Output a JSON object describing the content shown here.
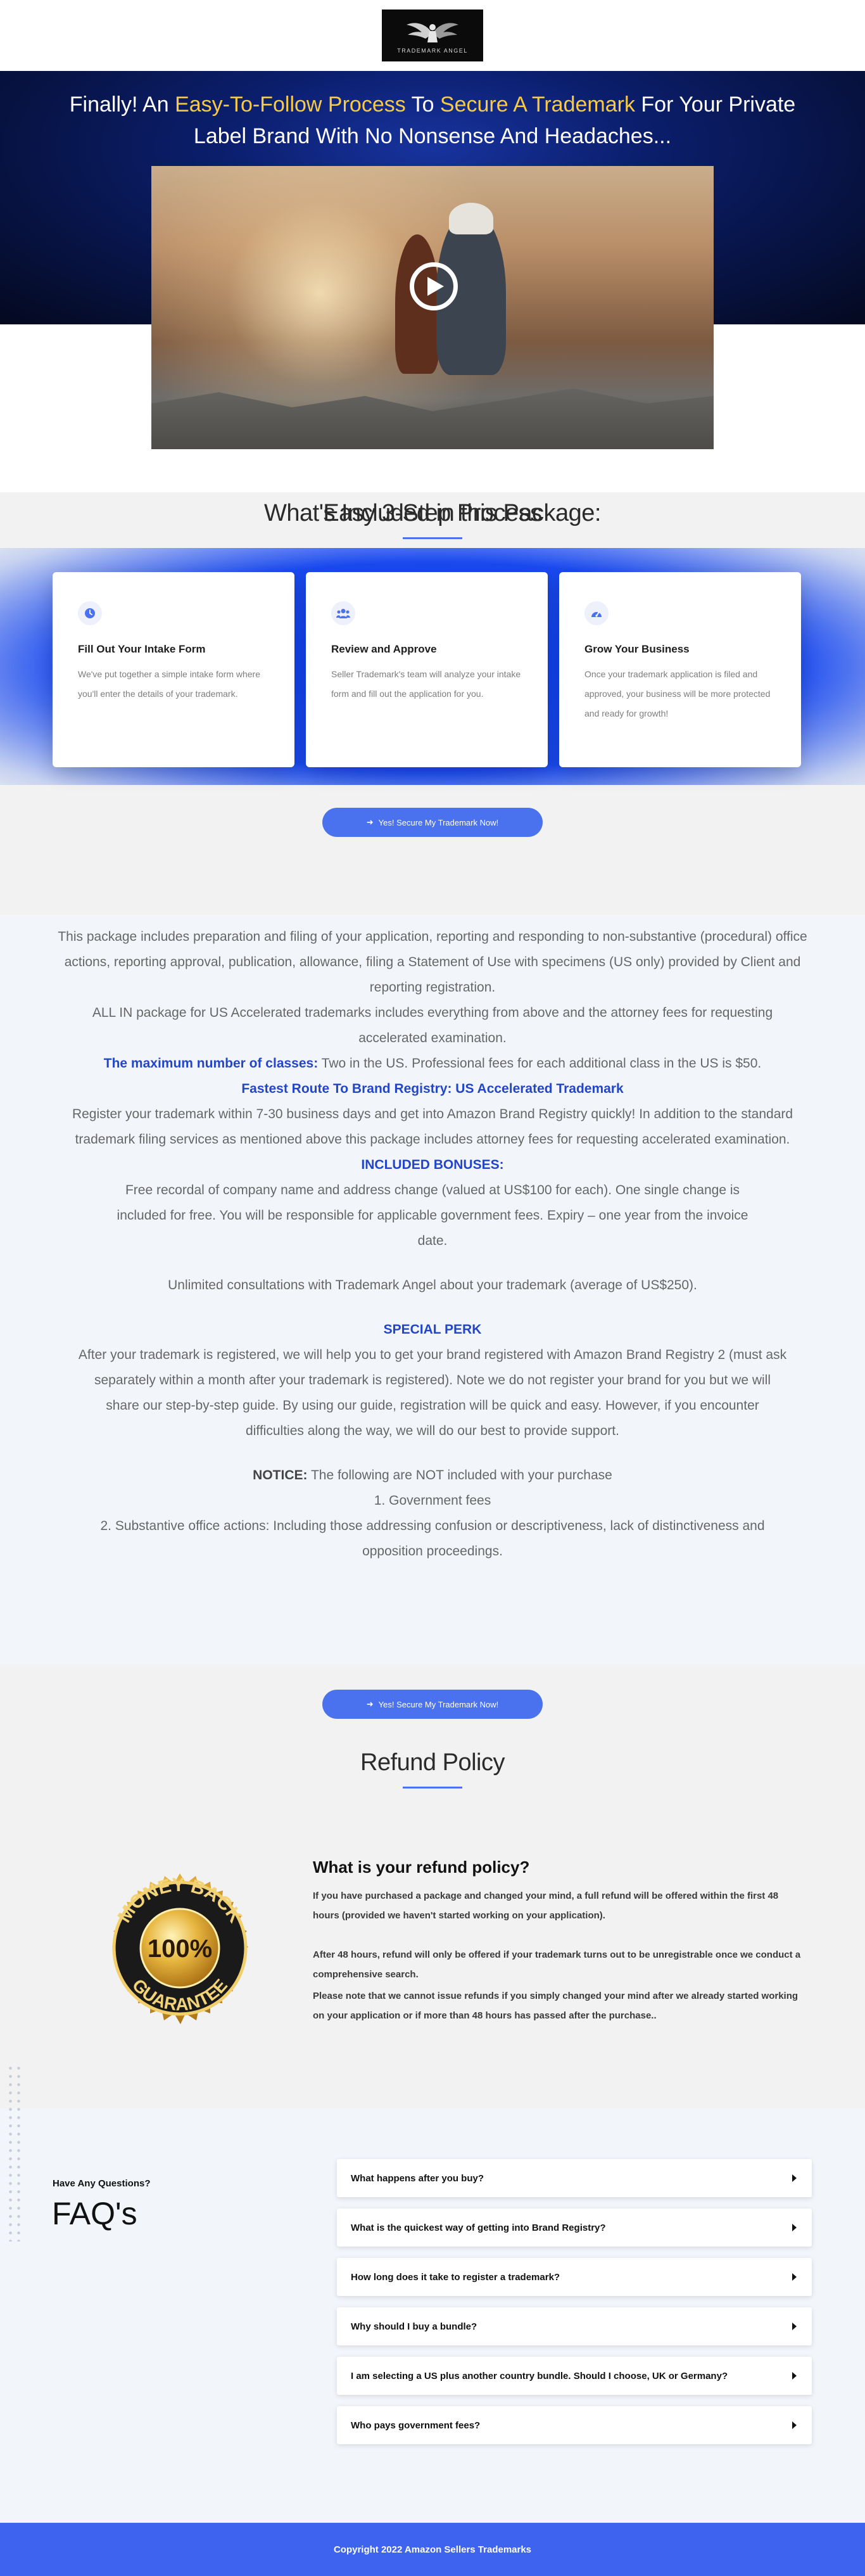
{
  "logo": {
    "text": "TRADEMARK ANGEL"
  },
  "hero": {
    "title_parts": [
      "Finally! An ",
      "Easy-To-Follow Process",
      " To ",
      "Secure A Trademark",
      " For Your Private Label Brand With No Nonsense And Headaches..."
    ],
    "accent_color": "#f7c948",
    "video": {
      "play_icon": "play-icon"
    }
  },
  "cta": {
    "label": "Yes! Secure My Trademark Now!",
    "icon": "arrow-right-icon",
    "color": "#4a72ef"
  },
  "steps_section": {
    "title": "Easy 3-Step Process",
    "steps": [
      {
        "icon": "clock-icon",
        "title": "Fill Out Your Intake Form",
        "text": "We've put together a simple intake form where you'll enter the details of your trademark."
      },
      {
        "icon": "users-icon",
        "title": "Review and Approve",
        "text": "Seller Trademark's team will analyze your intake form and fill out the application for you."
      },
      {
        "icon": "gauge-icon",
        "title": "Grow Your Business",
        "text": "Once your trademark application is filed and approved, your business will be more protected and ready for growth!"
      }
    ]
  },
  "package": {
    "title": "What's Included in this Package:",
    "intro": "This package includes preparation and filing of your application, reporting and responding to non-substantive (procedural) office actions, reporting approval, publication, allowance, filing a Statement of Use with specimens (US only) provided by Client and reporting registration.",
    "all_in": "ALL IN package for US Accelerated trademarks includes everything from above and the attorney fees for requesting accelerated examination.",
    "max_classes_label": "The maximum number of classes:",
    "max_classes_text": " Two in the US. Professional fees for each additional class in the US is $50.",
    "fastest_route": "Fastest Route To Brand Registry: US Accelerated Trademark",
    "register_text": "Register your trademark within 7-30 business days and get into Amazon Brand Registry quickly! In addition to the standard trademark filing services as mentioned above this package includes attorney fees for requesting accelerated examination.",
    "bonuses_heading": "INCLUDED BONUSES:",
    "bonus_1": "Free recordal of company name and address change (valued at US$100 for each). One single change is included for free. You will be responsible for applicable government fees. Expiry – one year from the invoice date.",
    "bonus_2": "Unlimited consultations with Trademark Angel about your trademark (average of US$250).",
    "perk_heading": "SPECIAL PERK",
    "perk_text": "After your trademark is registered, we will help you to get your brand registered with Amazon Brand Registry 2 (must ask separately within a month after your trademark is registered). Note we do not register your brand for you but we will share our step-by-step guide. By using our guide, registration will be quick and easy. However, if you encounter difficulties along the way, we will do our best to provide support.",
    "notice_label": "NOTICE:",
    "notice_text": " The following are NOT included with your purchase",
    "notice_1": "1. Government fees",
    "notice_2": "2. Substantive office actions: Including those addressing confusion or descriptiveness, lack of distinctiveness and opposition proceedings.",
    "highlight_color": "#2346c8"
  },
  "refund": {
    "title": "Refund Policy",
    "badge": {
      "line1": "MONEY BACK",
      "line2": "100%",
      "line3": "GUARANTEE"
    },
    "question": "What is your refund policy?",
    "p1": "If you have purchased a package and changed your mind, a full refund will be offered within the first 48 hours (provided we haven't started working on your application).",
    "p2": "After 48 hours, refund will only be offered if your trademark turns out to be unregistrable once we conduct a comprehensive search.",
    "p3": "Please note that we cannot issue refunds if you simply changed your mind after we already started working on your application or if more than 48 hours has passed after the purchase.."
  },
  "faq": {
    "kicker": "Have Any Questions?",
    "title": "FAQ's",
    "items": [
      "What happens after you buy?",
      "What is the quickest way of getting into Brand Registry?",
      "How long does it take to register a trademark?",
      "Why should I buy a bundle?",
      "I am selecting a US plus another country bundle. Should I choose, UK or Germany?",
      "Who pays government fees?"
    ]
  },
  "footer": {
    "text": "Copyright 2022 Amazon Sellers Trademarks",
    "color": "#3d63ef"
  }
}
